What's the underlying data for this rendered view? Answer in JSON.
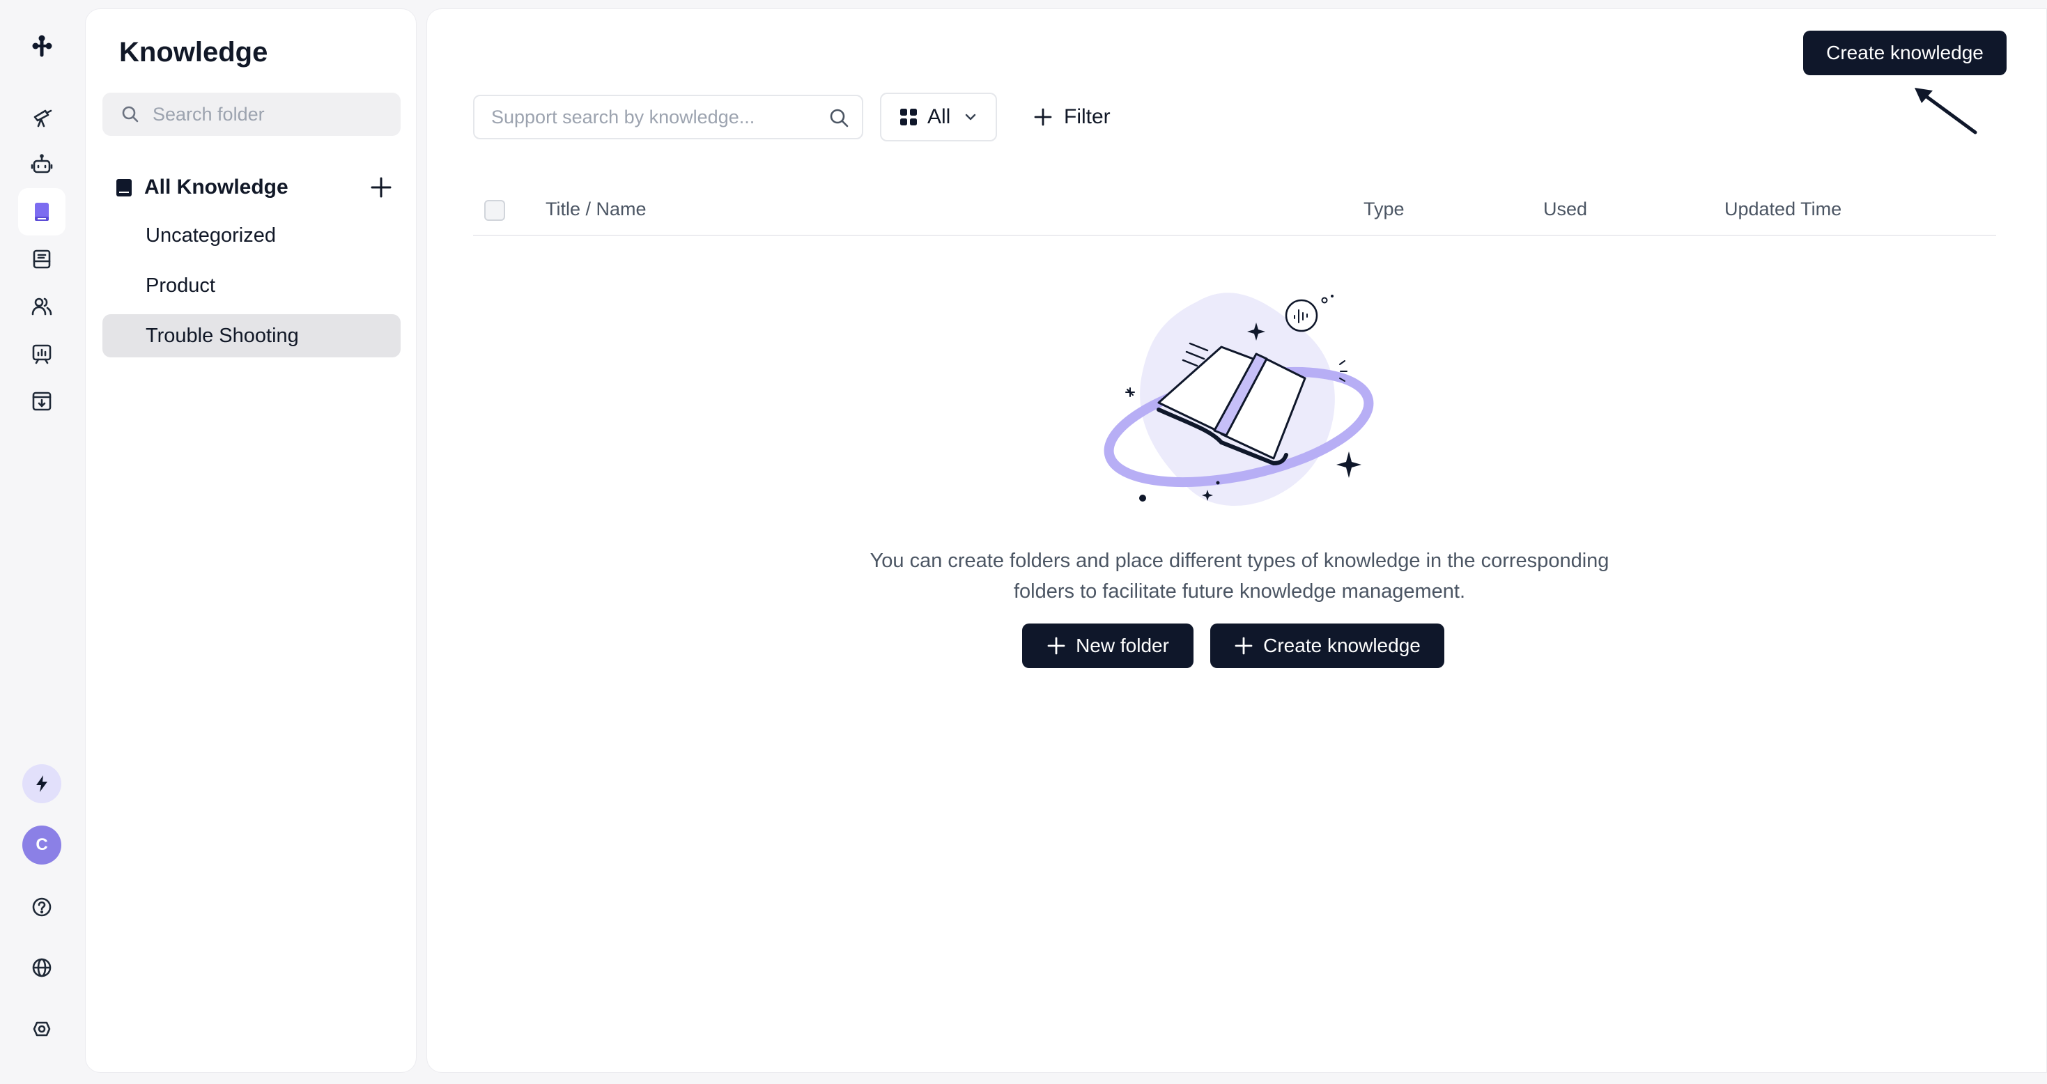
{
  "sidebar": {
    "items": [
      {
        "name": "rocket-icon"
      },
      {
        "name": "robot-icon"
      },
      {
        "name": "book-icon",
        "active": true
      },
      {
        "name": "inbox-icon"
      },
      {
        "name": "users-icon"
      },
      {
        "name": "chart-icon"
      },
      {
        "name": "download-box-icon"
      }
    ],
    "avatar_initial": "C",
    "accent_color": "#7c6cf0"
  },
  "folders": {
    "title": "Knowledge",
    "search_placeholder": "Search folder",
    "root_label": "All Knowledge",
    "items": [
      {
        "label": "Uncategorized",
        "selected": false
      },
      {
        "label": "Product",
        "selected": false
      },
      {
        "label": "Trouble Shooting",
        "selected": true
      }
    ]
  },
  "main": {
    "create_button": "Create knowledge",
    "search_placeholder": "Support search by knowledge...",
    "type_filter": {
      "selected": "All"
    },
    "filter_label": "Filter",
    "columns": [
      "Title / Name",
      "Type",
      "Used",
      "Updated Time"
    ],
    "empty": {
      "line1": "You can create folders and place different types of knowledge in the corresponding",
      "line2": "folders to facilitate future knowledge management.",
      "new_folder_button": "New folder",
      "create_button": "Create knowledge"
    }
  },
  "colors": {
    "primary_button": "#0f172a",
    "illustration_accent": "#bcb4f7",
    "illustration_blob": "#ecebfb"
  }
}
